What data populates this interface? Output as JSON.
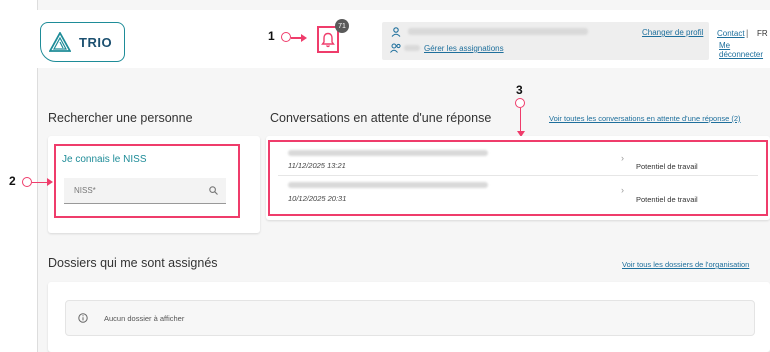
{
  "header": {
    "logo_text": "TRIO",
    "notification_count": "71",
    "change_profile": "Changer de profil",
    "manage_assignments": "Gérer les assignations",
    "contact": "Contact",
    "separator": "|",
    "language": "FR",
    "logout": "Me déconnecter"
  },
  "callouts": {
    "one": "1",
    "two": "2",
    "three": "3"
  },
  "search": {
    "title": "Rechercher une personne",
    "niss_link": "Je connais le NISS",
    "niss_placeholder": "NISS*"
  },
  "conversations": {
    "title": "Conversations en attente d'une réponse",
    "see_all": "Voir toutes les conversations en attente d'une réponse (2)",
    "items": [
      {
        "date": "11/12/2025 13:21",
        "type": "Potentiel de travail"
      },
      {
        "date": "10/12/2025 20:31",
        "type": "Potentiel de travail"
      }
    ]
  },
  "files": {
    "title": "Dossiers qui me sont assignés",
    "see_all": "Voir tous les dossiers de l'organisation",
    "empty": "Aucun dossier à afficher"
  },
  "colors": {
    "accent": "#ef3c6b",
    "brand": "#1e8c98",
    "link": "#1e6f9c"
  },
  "icons": [
    "trio-logo-icon",
    "bell-icon",
    "user-icon",
    "group-icon",
    "search-icon",
    "chevron-right-icon",
    "info-icon"
  ]
}
